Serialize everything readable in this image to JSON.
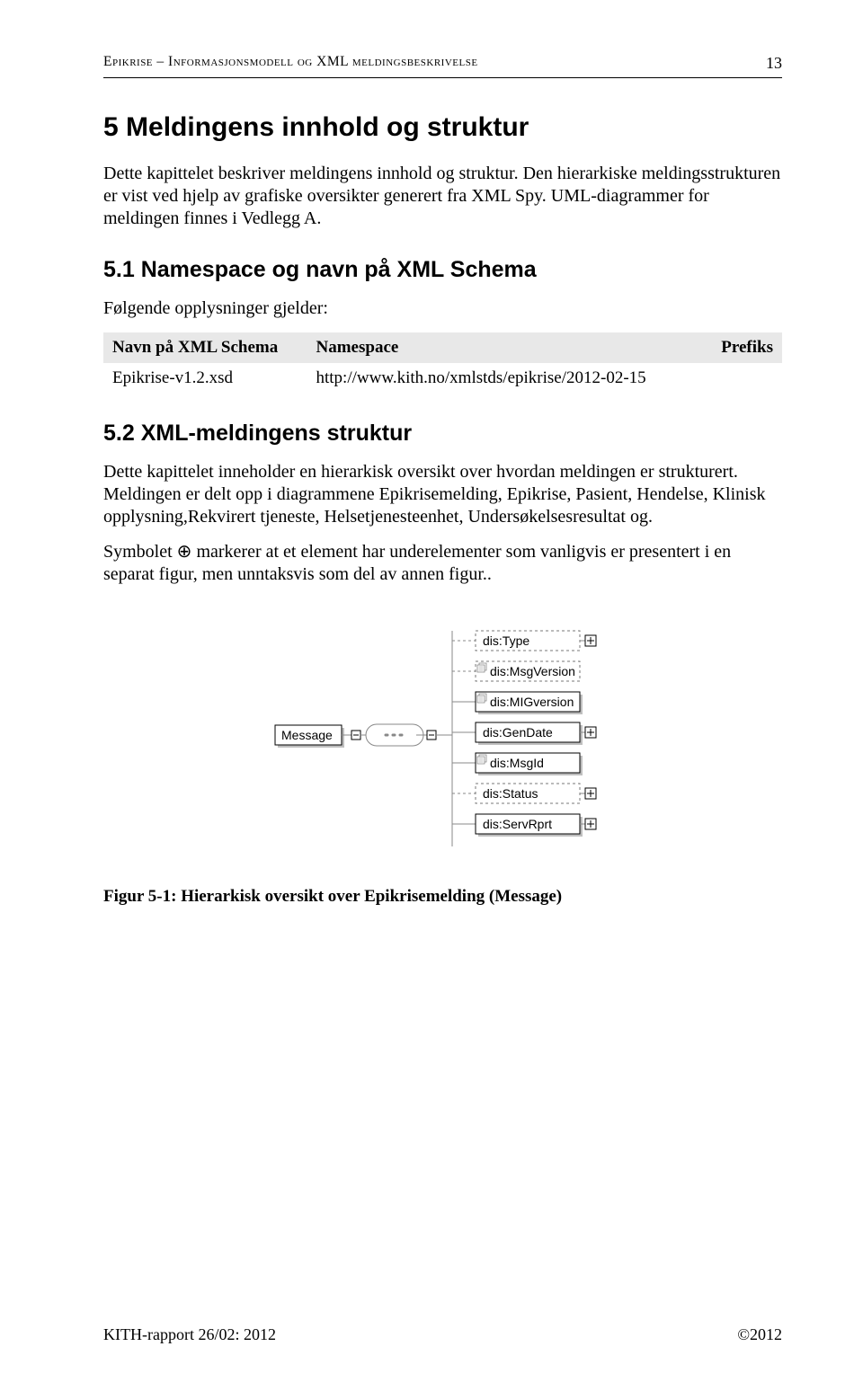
{
  "header": {
    "running": "Epikrise – Informasjonsmodell og XML meldingsbeskrivelse",
    "page_number": "13"
  },
  "section5": {
    "title": "5 Meldingens innhold og struktur",
    "intro_p1": "Dette kapittelet beskriver meldingens innhold og struktur. Den hierarkiske meldingsstrukturen er vist ved hjelp av grafiske oversikter generert fra XML Spy. UML-diagrammer for meldingen finnes i Vedlegg A."
  },
  "section5_1": {
    "title": "5.1 Namespace og navn på XML Schema",
    "lead": "Følgende opplysninger gjelder:",
    "table": {
      "headers": {
        "c1": "Navn på XML Schema",
        "c2": "Namespace",
        "c3": "Prefiks"
      },
      "rows": [
        {
          "c1": "Epikrise-v1.2.xsd",
          "c2": "http://www.kith.no/xmlstds/epikrise/2012-02-15",
          "c3": ""
        }
      ]
    }
  },
  "section5_2": {
    "title": "5.2 XML-meldingens struktur",
    "p1": "Dette kapittelet inneholder en hierarkisk oversikt over hvordan meldingen er strukturert. Meldingen er delt opp i diagrammene Epikrisemelding, Epikrise, Pasient, Hendelse, Klinisk opplysning,Rekvirert tjeneste, Helsetjenesteenhet, Undersøkelsesresultat og.",
    "p2_prefix": "Symbolet ",
    "p2_symbol": "⊕",
    "p2_suffix": " markerer at et element har underelementer som vanligvis er presentert i en separat figur, men unntaksvis som del av annen figur.."
  },
  "figure": {
    "root": "Message",
    "items": [
      {
        "label": "dis:Type",
        "style": "dashed",
        "plus": true
      },
      {
        "label": "dis:MsgVersion",
        "style": "dashed",
        "plus": false,
        "corner": true
      },
      {
        "label": "dis:MIGversion",
        "style": "solid",
        "plus": false,
        "corner": true
      },
      {
        "label": "dis:GenDate",
        "style": "solid",
        "plus": true
      },
      {
        "label": "dis:MsgId",
        "style": "solid",
        "plus": false,
        "corner": true
      },
      {
        "label": "dis:Status",
        "style": "dashed",
        "plus": true
      },
      {
        "label": "dis:ServRprt",
        "style": "solid",
        "plus": true
      }
    ],
    "caption": "Figur 5-1: Hierarkisk oversikt over Epikrisemelding (Message)"
  },
  "footer": {
    "left": "KITH-rapport 26/02: 2012",
    "right": "©2012"
  }
}
